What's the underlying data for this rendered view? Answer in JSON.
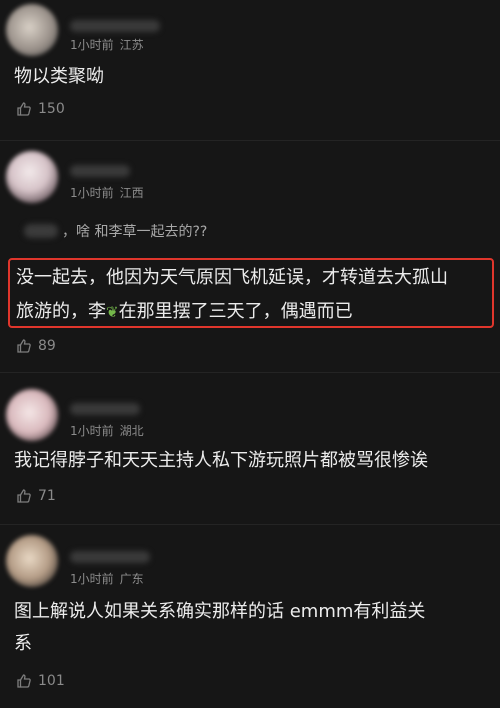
{
  "comments": [
    {
      "time": "1小时前",
      "location": "江苏",
      "text": "物以类聚呦",
      "likes": "150"
    },
    {
      "time": "1小时前",
      "location": "江西",
      "quote": "，啥 和李草一起去的??",
      "text_line1": "没一起去，他因为天气原因飞机延误，才转道去大孤山",
      "text_line2_a": "旅游的，李",
      "leaf_icon": "leaf-emoji",
      "text_line2_b": "在那里摆了三天了，偶遇而已",
      "likes": "89"
    },
    {
      "time": "1小时前",
      "location": "湖北",
      "text": "我记得脖子和天天主持人私下游玩照片都被骂很惨诶",
      "likes": "71"
    },
    {
      "time": "1小时前",
      "location": "广东",
      "text_line1": "图上解说人如果关系确实那样的话  emmm有利益关",
      "text_line2": "系",
      "likes": "101"
    }
  ],
  "colors": {
    "background": "#161616",
    "highlight_border": "#e0362c",
    "meta_text": "#8c8c8c"
  }
}
